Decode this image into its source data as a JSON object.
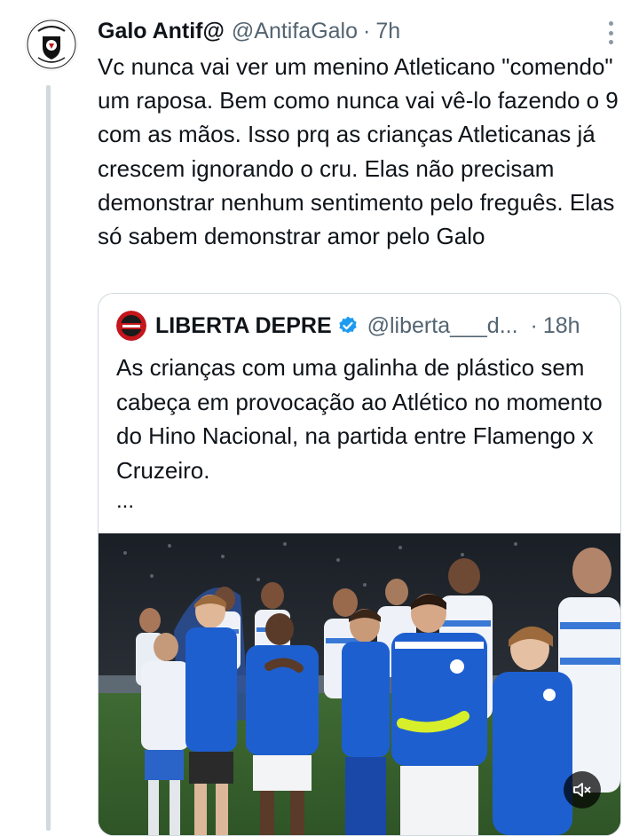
{
  "tweet": {
    "display_name": "Galo Antif@",
    "handle": "@AntifaGalo",
    "separator": "·",
    "time": "7h",
    "text": "Vc nunca vai ver um menino Atleticano \"comendo\" um raposa. Bem como nunca vai vê-lo fazendo o 9 com as mãos. Isso prq as crianças Atleticanas já crescem ignorando o cru. Elas não precisam demonstrar nenhum sentimento pelo freguês. Elas só sabem demonstrar amor pelo Galo",
    "more_icon": "more-vertical-icon",
    "avatar_icon": "galo-antifa-logo"
  },
  "quote": {
    "display_name": "LIBERTA DEPRE",
    "handle": "@liberta___d...",
    "separator": "·",
    "time": "18h",
    "verified_icon": "verified-badge-icon",
    "text": "As crianças com uma galinha de plástico sem cabeça em provocação ao Atlético no momento do Hino Nacional, na partida entre Flamengo x Cruzeiro.",
    "truncation": "...",
    "media": {
      "type": "video",
      "mute_icon": "speaker-muted-icon"
    }
  },
  "colors": {
    "text_primary": "#0f1419",
    "text_secondary": "#536471",
    "border": "#cfd9de",
    "verified": "#1d9bf0",
    "cruzeiro_blue": "#1e5fd0"
  }
}
